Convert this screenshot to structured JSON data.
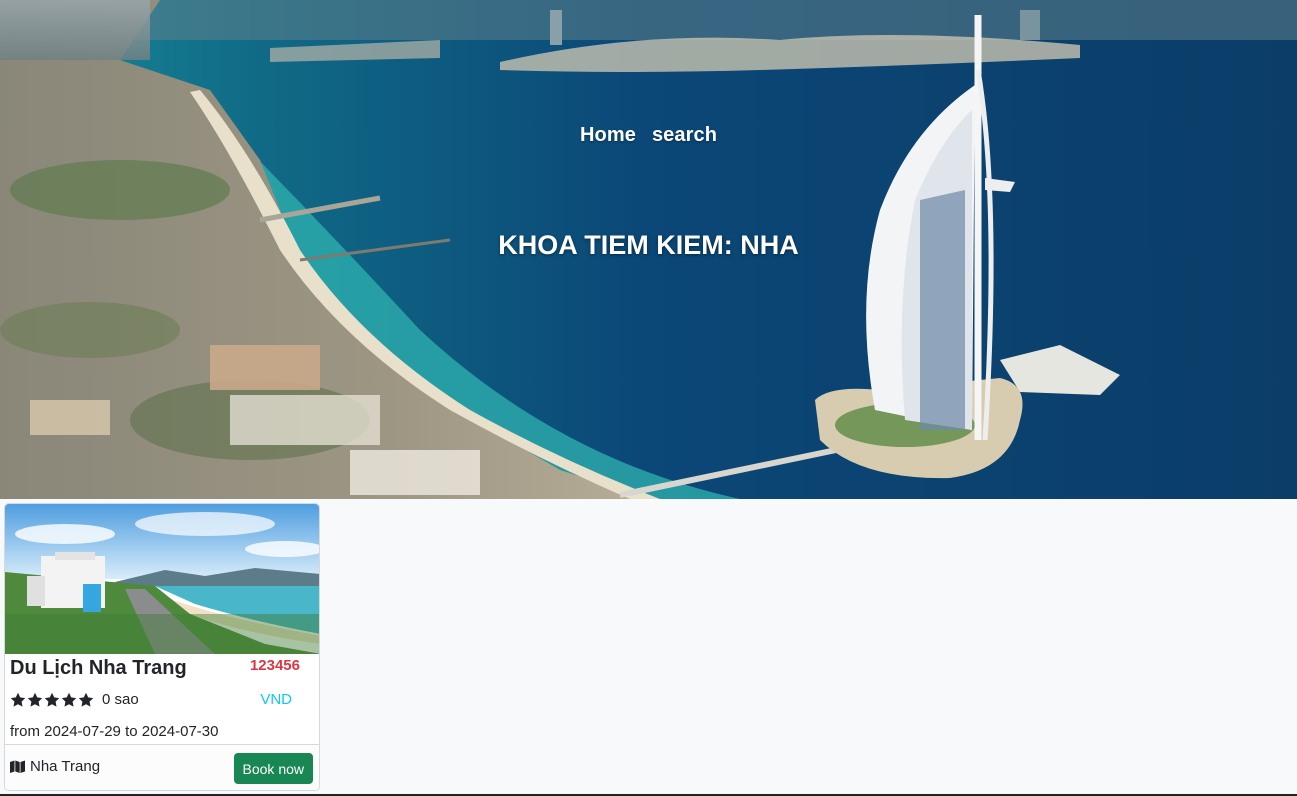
{
  "nav": {
    "items": [
      {
        "label": "Home"
      },
      {
        "label": "search"
      }
    ]
  },
  "hero": {
    "title": "KHOA TIEM KIEM: NHA"
  },
  "results": [
    {
      "title": "Du Lịch Nha Trang",
      "price": "123456",
      "currency": "VND",
      "stars": 5,
      "stars_text": "0 sao",
      "dates": "from 2024-07-29 to 2024-07-30",
      "location": "Nha Trang",
      "book_label": "Book now",
      "icons": {
        "rating": "star-icon",
        "location": "map-icon"
      }
    }
  ],
  "colors": {
    "price": "#dc3545",
    "currency": "#0dcaf0",
    "book_button": "#198754",
    "page_bg": "#f8f9fa"
  }
}
